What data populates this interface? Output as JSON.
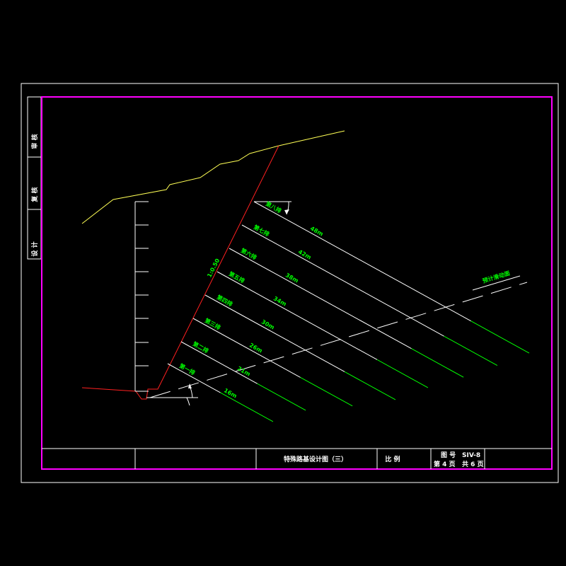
{
  "drawing": {
    "title": "特殊路基设计图（三）",
    "scale_label": "比 例",
    "drawing_no_label": "图 号",
    "drawing_no": "SIV-8",
    "page_text": "第 4 页",
    "total_text": "共 6 页"
  },
  "side_labels": [
    "审 核",
    "复 核",
    "设 计"
  ],
  "slope_ratio": "1:0.50",
  "anchor_zone_label": "预计滑动面",
  "anchors": [
    {
      "name": "第一排",
      "length": "16m"
    },
    {
      "name": "第二排",
      "length": "21m"
    },
    {
      "name": "第三排",
      "length": "26m"
    },
    {
      "name": "第四排",
      "length": "30m"
    },
    {
      "name": "第五排",
      "length": "34m"
    },
    {
      "name": "第六排",
      "length": "38m"
    },
    {
      "name": "第七排",
      "length": "42m"
    },
    {
      "name": "第八排",
      "length": "48m"
    }
  ],
  "colors": {
    "frame": "#ffffff",
    "border": "#ff00ff",
    "ground": "#ffff55",
    "slope": "#ff2020",
    "anchor": "#ffffff",
    "anchor_tail": "#00ff00",
    "label": "#00ff00"
  }
}
